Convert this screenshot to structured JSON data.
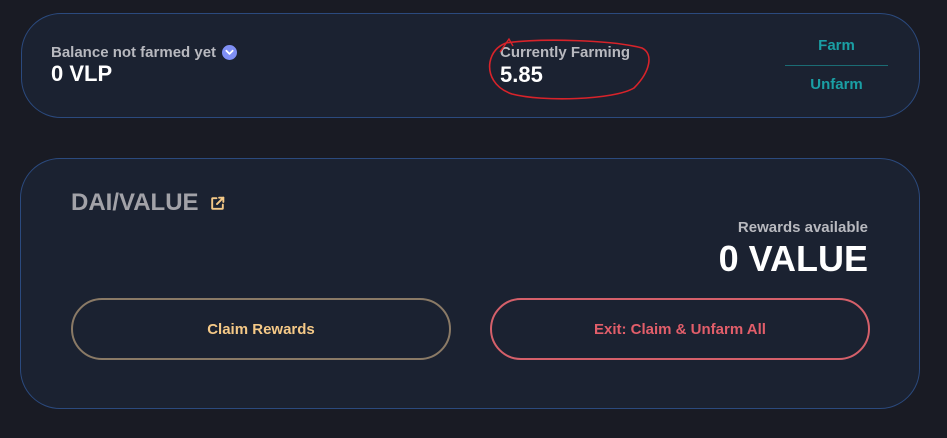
{
  "colors": {
    "background": "#191b24",
    "card_background": "#1b2231",
    "card_border": "#2b4a7e",
    "accent_teal": "#1a9fa4",
    "accent_gold": "#f5c987",
    "accent_red": "#e25e6a",
    "annotation_red": "#d8232a"
  },
  "summary": {
    "balance_label": "Balance not farmed yet",
    "balance_icon": "chevron-down-circle-icon",
    "balance_value": "0 VLP",
    "farming_label": "Currently Farming",
    "farming_value": "5.85",
    "farm_label": "Farm",
    "unfarm_label": "Unfarm"
  },
  "pool": {
    "pair_name": "DAI/VALUE",
    "external_link_icon": "external-link-icon",
    "rewards_label": "Rewards available",
    "rewards_value": "0 VALUE",
    "claim_label": "Claim Rewards",
    "exit_label": "Exit: Claim & Unfarm All"
  }
}
